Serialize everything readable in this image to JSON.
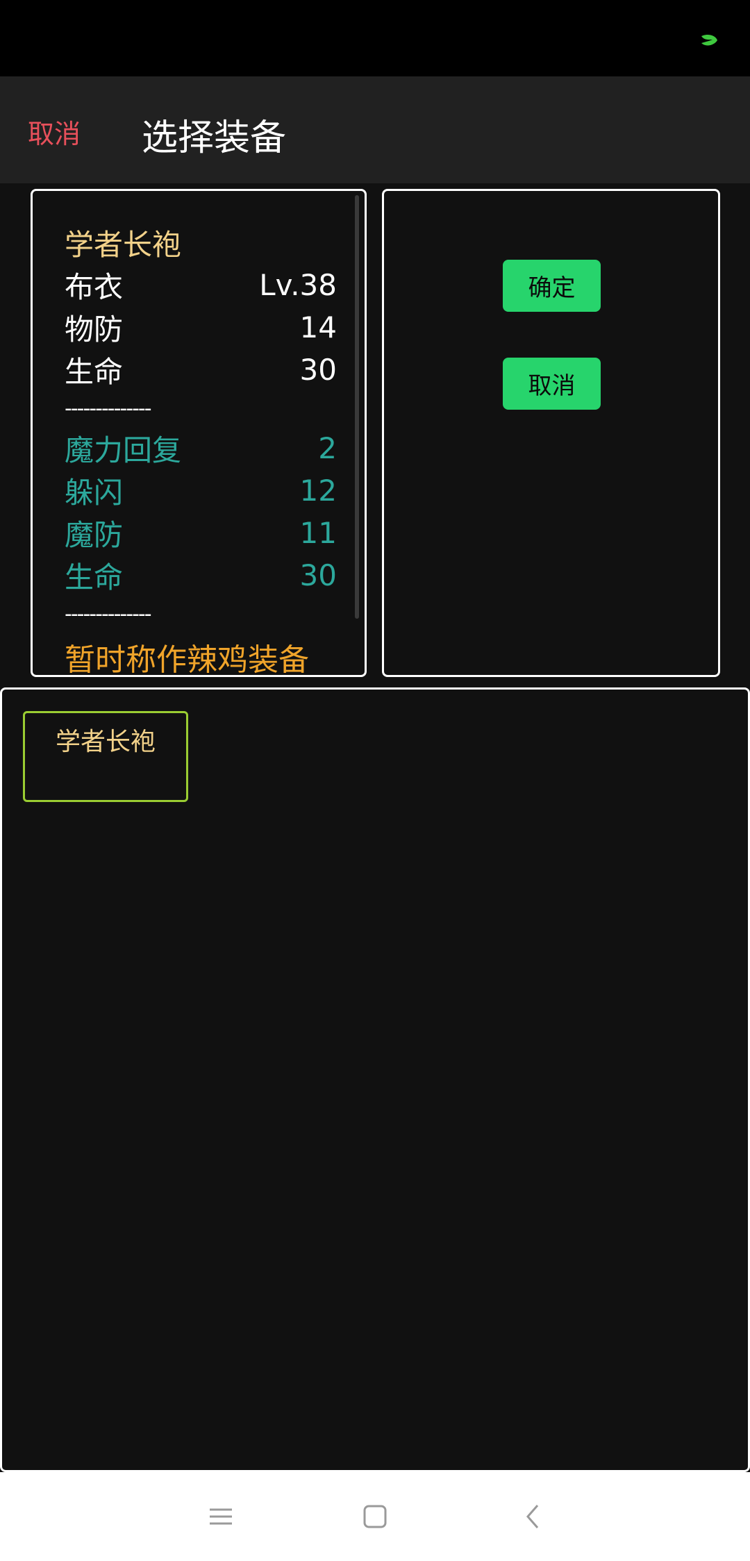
{
  "header": {
    "cancel_label": "取消",
    "title": "选择装备"
  },
  "detail": {
    "name": "学者长袍",
    "type": "布衣",
    "level": "Lv.38",
    "base_stats": [
      {
        "label": "物防",
        "value": "14"
      },
      {
        "label": "生命",
        "value": "30"
      }
    ],
    "divider": "--------------",
    "bonus_stats": [
      {
        "label": "魔力回复",
        "value": "2"
      },
      {
        "label": "躲闪",
        "value": "12"
      },
      {
        "label": "魔防",
        "value": "11"
      },
      {
        "label": "生命",
        "value": "30"
      }
    ],
    "flavor": "暂时称作辣鸡装备"
  },
  "actions": {
    "confirm_label": "确定",
    "cancel_label": "取消"
  },
  "list": {
    "items": [
      {
        "label": "学者长袍"
      }
    ]
  },
  "icons": {
    "status": "leaf-icon",
    "nav_menu": "menu-icon",
    "nav_home": "home-icon",
    "nav_back": "back-icon"
  },
  "colors": {
    "accent_button": "#27d46c",
    "cancel_text": "#e8505b",
    "item_name": "#f3d28a",
    "bonus_stat": "#2ca89c",
    "flavor_text": "#f0a42a",
    "item_border": "#9acd32"
  }
}
